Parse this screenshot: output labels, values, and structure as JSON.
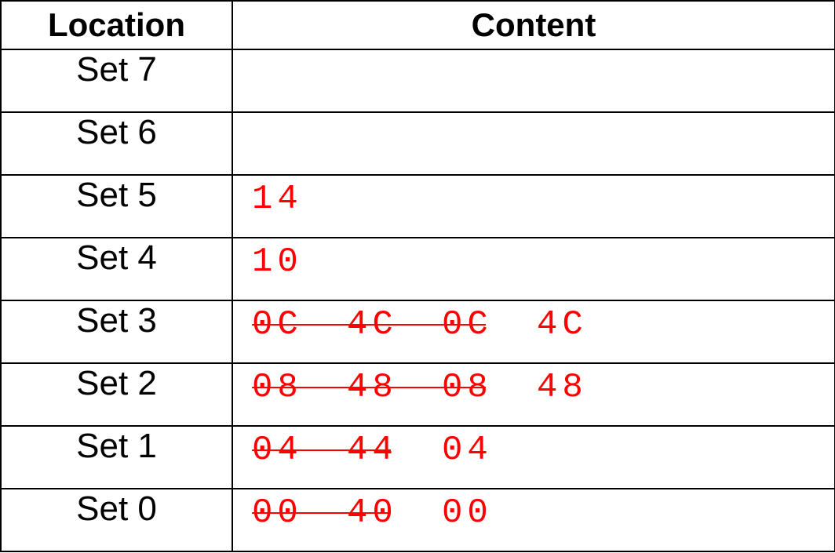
{
  "table": {
    "headers": {
      "location": "Location",
      "content": "Content"
    },
    "rows": [
      {
        "location": "Set 7",
        "entries": []
      },
      {
        "location": "Set 6",
        "entries": []
      },
      {
        "location": "Set 5",
        "entries": [
          {
            "value": "14",
            "evicted": false
          }
        ]
      },
      {
        "location": "Set 4",
        "entries": [
          {
            "value": "10",
            "evicted": false
          }
        ]
      },
      {
        "location": "Set 3",
        "entries": [
          {
            "value": "0C",
            "evicted": true
          },
          {
            "value": "4C",
            "evicted": true
          },
          {
            "value": "0C",
            "evicted": true
          },
          {
            "value": "4C",
            "evicted": false
          }
        ]
      },
      {
        "location": "Set 2",
        "entries": [
          {
            "value": "08",
            "evicted": true
          },
          {
            "value": "48",
            "evicted": true
          },
          {
            "value": "08",
            "evicted": true
          },
          {
            "value": "48",
            "evicted": false
          }
        ]
      },
      {
        "location": "Set 1",
        "entries": [
          {
            "value": "04",
            "evicted": true
          },
          {
            "value": "44",
            "evicted": true
          },
          {
            "value": "04",
            "evicted": false
          }
        ]
      },
      {
        "location": "Set 0",
        "entries": [
          {
            "value": "00",
            "evicted": true
          },
          {
            "value": "40",
            "evicted": true
          },
          {
            "value": "00",
            "evicted": false
          }
        ]
      }
    ]
  },
  "colors": {
    "entry_text": "#ff0000",
    "strike": "#ff0000",
    "border": "#000000"
  }
}
